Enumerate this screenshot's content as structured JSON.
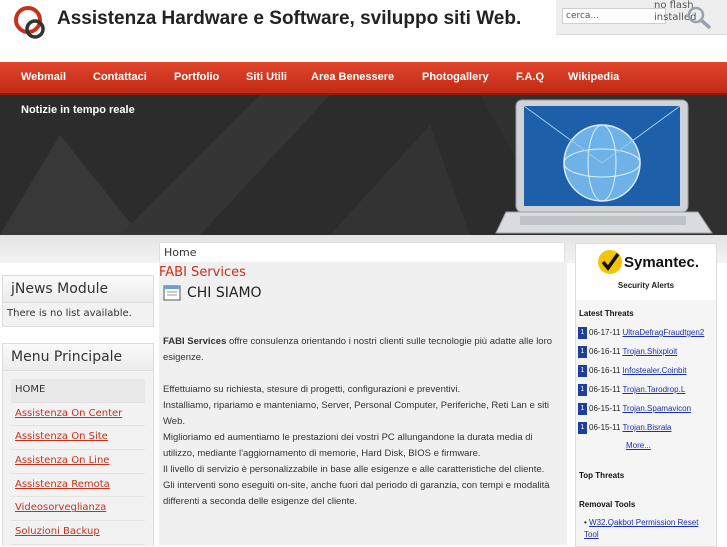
{
  "header": {
    "site_title": "Assistenza Hardware e Software, sviluppo siti Web.",
    "search_placeholder": "cerca...",
    "noflash_text": "no flash installed"
  },
  "nav": {
    "items": [
      "Webmail",
      "Contattaci",
      "Portfolio",
      "Siti Utili",
      "Area Benessere",
      "Photogallery",
      "F.A.Q",
      "Wikipedia"
    ]
  },
  "banner": {
    "title": "Notizie in tempo reale"
  },
  "breadcrumb": {
    "home": "Home"
  },
  "content": {
    "heading": "FABI Services",
    "section_title": "CHI SIAMO",
    "intro_bold": "FABI Services",
    "intro_rest": " offre consulenza orientando i nostri clienti sulle tecnologie più adatte alle loro esigenze.",
    "paragraphs": [
      "Effettuiamo su richiesta, stesure di progetti, configurazioni e preventivi.",
      "Installiamo, ripariamo e manteniamo, Server, Personal Computer, Periferiche, Reti Lan e siti Web.",
      "Miglioriamo ed aumentiamo le prestazioni dei vostri PC allungandone la durata media di utilizzo, mediante l'aggiornamento di memorie, Hard Disk, BIOS e firmware.",
      "Il livello di servizio è personalizzabile in base alle esigenze e alle caratteristiche del cliente.",
      "Gli interventi sono eseguiti on-site, anche fuori dal periodo di garanzia, con tempi e modalità differenti a seconda delle esigenze del cliente."
    ]
  },
  "jnews": {
    "title": "jNews Module",
    "text": "There is no list available."
  },
  "menu": {
    "title": "Menu Principale",
    "items": [
      "HOME",
      "Assistenza On Center",
      "Assistenza On Site",
      "Assistenza On Line",
      "Assistenza Remota",
      "Videosorveglianza",
      "Soluzioni Backup"
    ]
  },
  "symantec": {
    "brand": "Symantec.",
    "alerts_title": "Security Alerts",
    "latest_threats_title": "Latest Threats",
    "threats": [
      {
        "rank": "1",
        "date": "06-17-11",
        "name": "UltraDefragFraudtgen2"
      },
      {
        "rank": "1",
        "date": "06-16-11",
        "name": "Trojan.Shixploit"
      },
      {
        "rank": "1",
        "date": "06-16-11",
        "name": "Infostealer.Coinbit"
      },
      {
        "rank": "1",
        "date": "06-15-11",
        "name": "Trojan.Tarodrop.L"
      },
      {
        "rank": "1",
        "date": "06-15-11",
        "name": "Trojan.Spamavicon"
      },
      {
        "rank": "1",
        "date": "06-15-11",
        "name": "Trojan.Bisrala"
      }
    ],
    "more_label": "More...",
    "top_threats_title": "Top Threats",
    "removal_tools_title": "Removal Tools",
    "removal_tools": [
      "W32.Qakbot Permission Reset Tool"
    ]
  },
  "colors": {
    "accent": "#c8301b",
    "nav": "#d33a22",
    "link_blue": "#1a2fb8"
  }
}
